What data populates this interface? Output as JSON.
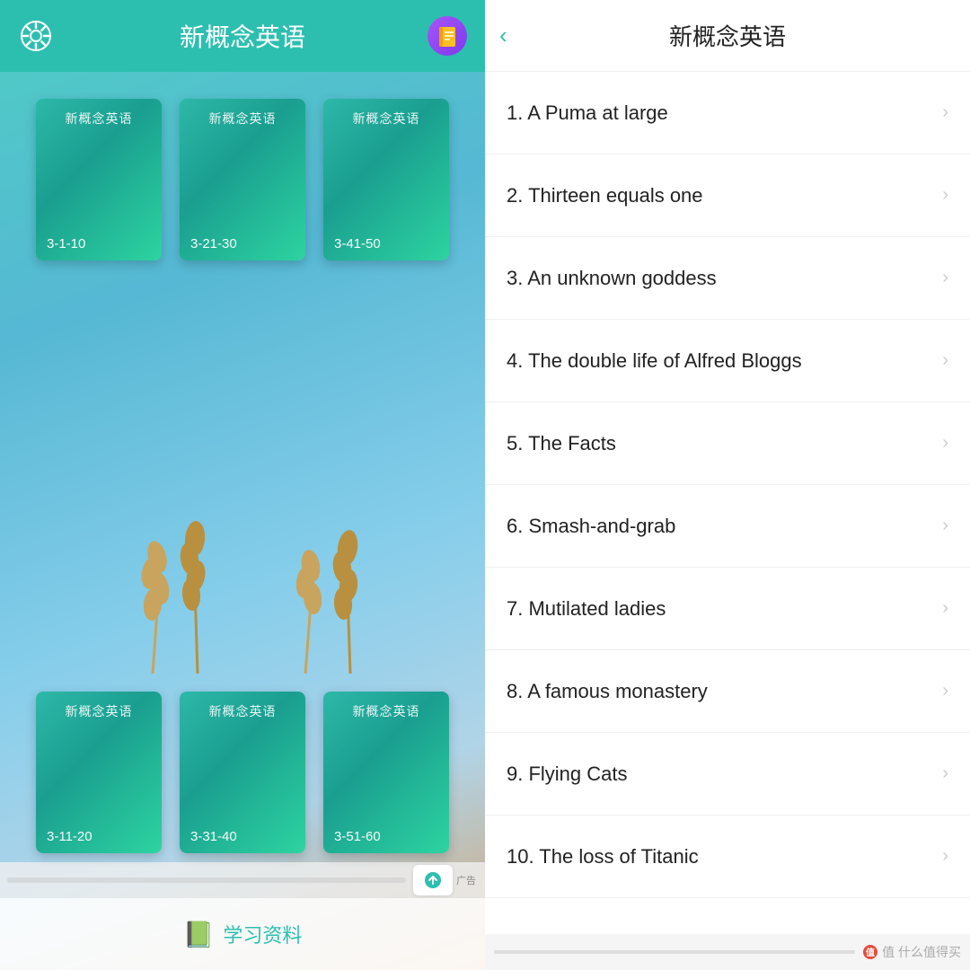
{
  "left": {
    "header": {
      "title": "新概念英语",
      "book_icon": "📗"
    },
    "books_top": [
      {
        "title": "新概念英语",
        "range": "3-1-10"
      },
      {
        "title": "新概念英语",
        "range": "3-21-30"
      },
      {
        "title": "新概念英语",
        "range": "3-41-50"
      }
    ],
    "books_bottom": [
      {
        "title": "新概念英语",
        "range": "3-11-20"
      },
      {
        "title": "新概念英语",
        "range": "3-31-40"
      },
      {
        "title": "新概念英语",
        "range": "3-51-60"
      }
    ],
    "bottom_bar": {
      "label": "学习资料"
    }
  },
  "right": {
    "header": {
      "title": "新概念英语",
      "back_label": "‹"
    },
    "lessons": [
      {
        "id": 1,
        "title": "1. A Puma at large"
      },
      {
        "id": 2,
        "title": "2. Thirteen equals one"
      },
      {
        "id": 3,
        "title": "3. An unknown goddess"
      },
      {
        "id": 4,
        "title": "4. The double life of Alfred Bloggs"
      },
      {
        "id": 5,
        "title": "5. The Facts"
      },
      {
        "id": 6,
        "title": "6. Smash-and-grab"
      },
      {
        "id": 7,
        "title": "7. Mutilated ladies"
      },
      {
        "id": 8,
        "title": "8. A famous monastery"
      },
      {
        "id": 9,
        "title": "9. Flying Cats"
      },
      {
        "id": 10,
        "title": "10. The loss of Titanic"
      }
    ],
    "watermark": "值 什么值得买"
  }
}
